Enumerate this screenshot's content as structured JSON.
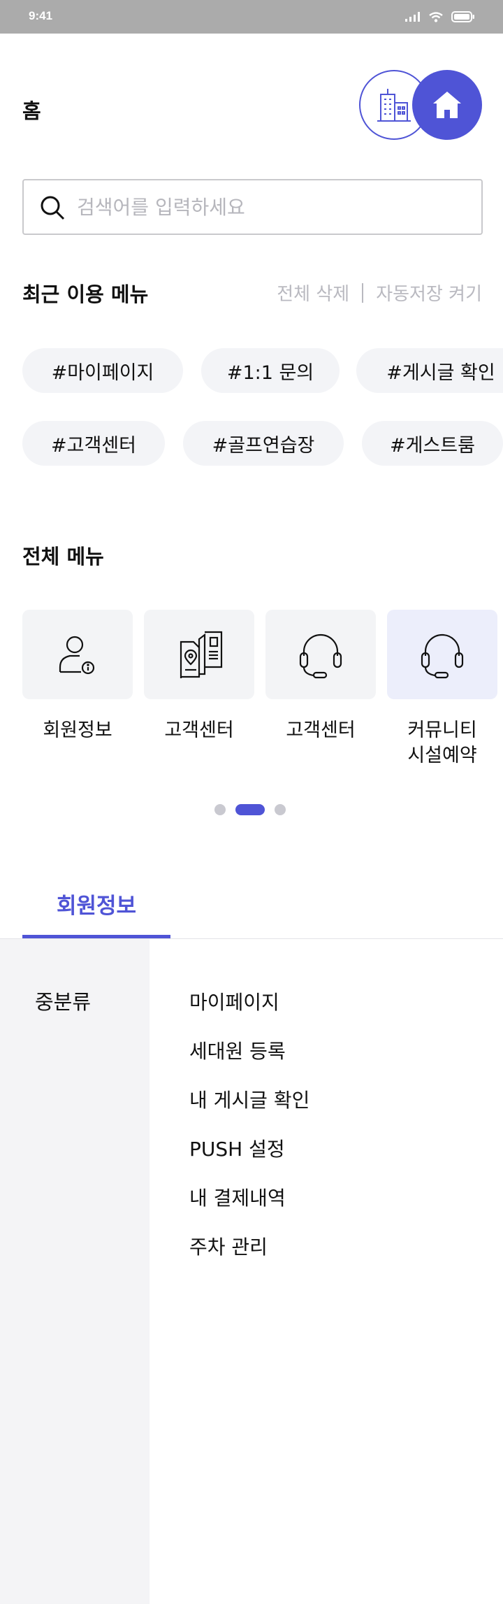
{
  "status_bar": {
    "time": "9:41"
  },
  "header": {
    "title": "홈"
  },
  "search": {
    "placeholder": "검색어를 입력하세요"
  },
  "recent": {
    "title": "최근 이용 메뉴",
    "delete_all": "전체 삭제",
    "autosave": "자동저장 켜기",
    "chips": [
      "#마이페이지",
      "#1:1 문의",
      "#게시글 확인",
      "#고객센터",
      "#골프연습장",
      "#게스트룸"
    ]
  },
  "all_menu": {
    "title": "전체 메뉴",
    "items": [
      {
        "label": "회원정보",
        "icon": "member-info-icon"
      },
      {
        "label": "고객센터",
        "icon": "document-location-icon"
      },
      {
        "label": "고객센터",
        "icon": "headset-icon"
      },
      {
        "label": "커뮤니티\n시설예약",
        "icon": "headset-icon"
      }
    ],
    "pagination": {
      "pages": 3,
      "current": 2
    }
  },
  "category": {
    "tab": "회원정보",
    "side_label": "중분류",
    "items": [
      "마이페이지",
      "세대원 등록",
      "내 게시글 확인",
      "PUSH 설정",
      "내 결제내역",
      "주차 관리"
    ]
  },
  "colors": {
    "accent": "#4f54d6",
    "chip_bg": "#f3f4f7",
    "muted": "#b9b9c0"
  }
}
